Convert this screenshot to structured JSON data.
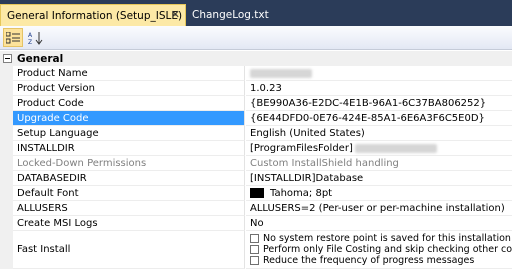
{
  "tabs": [
    {
      "label": "General Information (Setup_ISLE)",
      "close": "✕"
    },
    {
      "label": "ChangeLog.txt"
    }
  ],
  "category": "General",
  "properties": [
    {
      "name": "Product Name",
      "value": ""
    },
    {
      "name": "Product Version",
      "value": "1.0.23"
    },
    {
      "name": "Product Code",
      "value": "{BE990A36-E2DC-4E1B-96A1-6C37BA806252}"
    },
    {
      "name": "Upgrade Code",
      "value": "{6E44DFD0-0E76-424E-85A1-6E6A3F6C5E0D}"
    },
    {
      "name": "Setup Language",
      "value": "English (United States)"
    },
    {
      "name": "INSTALLDIR",
      "value": "[ProgramFilesFolder]"
    },
    {
      "name": "Locked-Down Permissions",
      "value": "Custom InstallShield handling"
    },
    {
      "name": "DATABASEDIR",
      "value": "[INSTALLDIR]Database"
    },
    {
      "name": "Default Font",
      "value": "Tahoma; 8pt"
    },
    {
      "name": "ALLUSERS",
      "value": "ALLUSERS=2 (Per-user or per-machine installation)"
    },
    {
      "name": "Create MSI Logs",
      "value": "No"
    },
    {
      "name": "Fast Install",
      "options": [
        "No system restore point is saved for this installation",
        "Perform only File Costing and skip checking other costs",
        "Reduce the frequency of progress messages"
      ]
    }
  ]
}
